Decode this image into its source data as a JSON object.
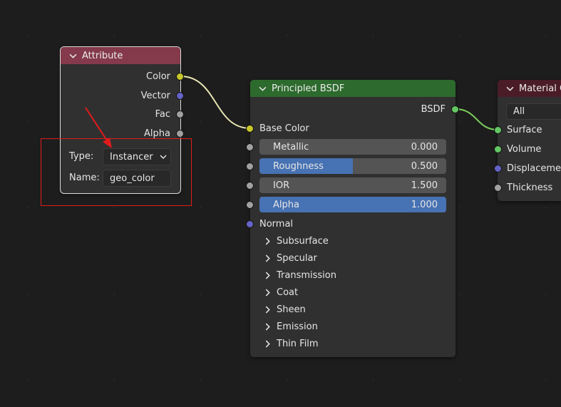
{
  "colors": {
    "attribute_header": "#843a4a",
    "bsdf_header": "#2d6a2d",
    "output_header": "#4a1c28",
    "socket_color": "#c7c729",
    "socket_vector": "#6363c7",
    "socket_float": "#a1a1a1",
    "socket_shader": "#63c763",
    "slider_fill": "#4772b3",
    "highlight": "#e01b1b",
    "link": "#e8e6b3"
  },
  "attribute_node": {
    "title": "Attribute",
    "outputs": [
      {
        "label": "Color",
        "socket": "color"
      },
      {
        "label": "Vector",
        "socket": "vector"
      },
      {
        "label": "Fac",
        "socket": "float"
      },
      {
        "label": "Alpha",
        "socket": "float"
      }
    ],
    "type_label": "Type:",
    "type_value": "Instancer",
    "name_label": "Name:",
    "name_value": "geo_color"
  },
  "bsdf_node": {
    "title": "Principled BSDF",
    "output": "BSDF",
    "base_color": "Base Color",
    "fields": [
      {
        "label": "Metallic",
        "value": "0.000",
        "fill": 0.0
      },
      {
        "label": "Roughness",
        "value": "0.500",
        "fill": 0.5
      },
      {
        "label": "IOR",
        "value": "1.500",
        "fill": 0.0
      },
      {
        "label": "Alpha",
        "value": "1.000",
        "fill": 1.0
      }
    ],
    "normal": "Normal",
    "panels": [
      "Subsurface",
      "Specular",
      "Transmission",
      "Coat",
      "Sheen",
      "Emission",
      "Thin Film"
    ]
  },
  "output_node": {
    "title": "Material O",
    "target": "All",
    "inputs": [
      "Surface",
      "Volume",
      "Displacemer",
      "Thickness"
    ]
  }
}
